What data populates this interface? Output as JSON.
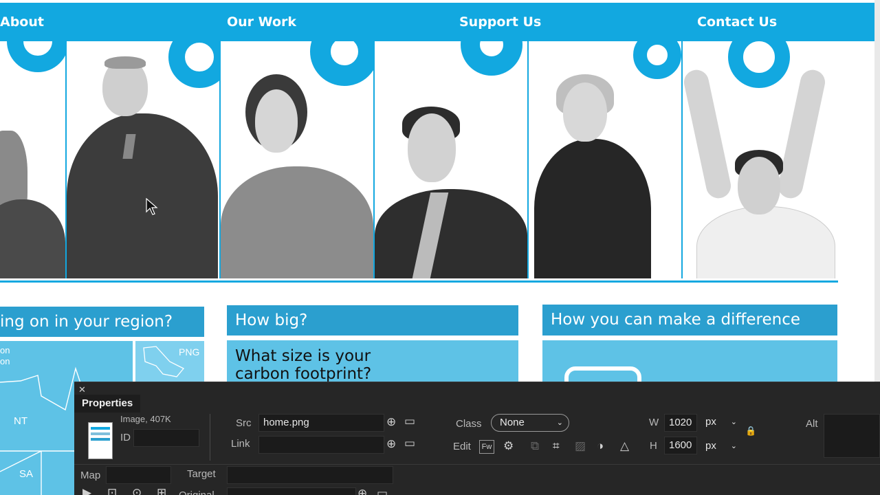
{
  "nav": {
    "items": [
      "About",
      "Our Work",
      "Support Us",
      "Contact Us"
    ]
  },
  "boxes": {
    "region_title": "ing on in your region?",
    "map_labels": [
      "on",
      "on",
      "NT",
      "SA",
      "PNG"
    ],
    "howbig_title": "How big?",
    "howbig_text": "What size is your carbon footprint?",
    "difference_title": "How you can make a difference"
  },
  "properties": {
    "tab_title": "Properties",
    "image_info": "Image, 407K",
    "id_label": "ID",
    "src_label": "Src",
    "src_value": "home.png",
    "link_label": "Link",
    "class_label": "Class",
    "class_value": "None",
    "edit_label": "Edit",
    "fw_label": "Fw",
    "w_label": "W",
    "w_value": "1020",
    "h_label": "H",
    "h_value": "1600",
    "unit_w": "px",
    "unit_h": "px",
    "alt_label": "Alt",
    "map_label": "Map",
    "target_label": "Target",
    "original_label": "Original"
  },
  "icons": [
    "close-icon",
    "crosshair-icon",
    "folder-icon",
    "chevron-down-icon",
    "lock-icon",
    "gear-icon",
    "crop-icon",
    "brightness-icon",
    "sharpen-icon",
    "cursor-icon"
  ],
  "colors": {
    "brand": "#12a8e0",
    "panel": "#262626"
  }
}
